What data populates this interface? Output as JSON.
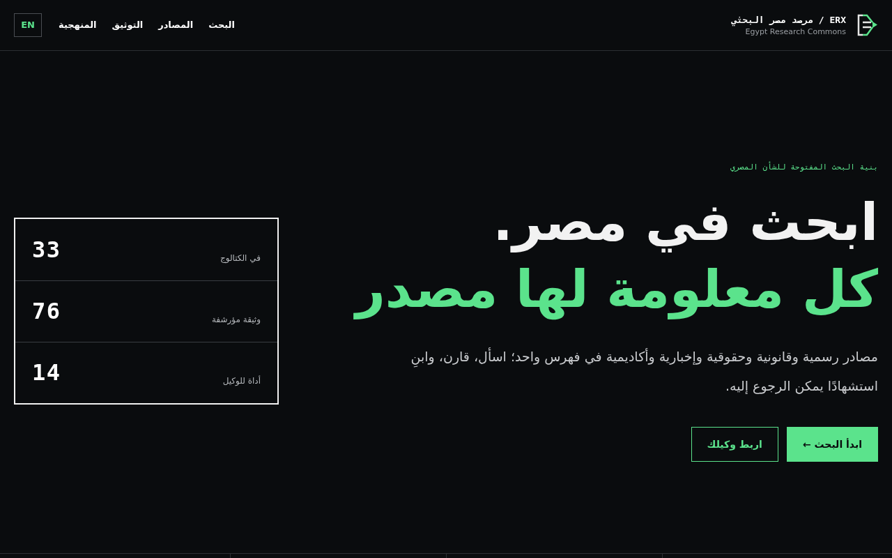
{
  "header": {
    "logo": {
      "title": "ERX / مرصد مصر البحثي",
      "subtitle": "Egypt Research Commons"
    },
    "nav": [
      {
        "label": "البحث"
      },
      {
        "label": "المصادر"
      },
      {
        "label": "التوثيق"
      },
      {
        "label": "المنهجية"
      }
    ],
    "language_button": "EN"
  },
  "hero": {
    "eyebrow": "بنية البحث المفتوحة للشأن المصري",
    "headline": {
      "line_1": "ابحث في مصر.",
      "line_2": "كل معلومة لها مصدر"
    },
    "description": "مصادر رسمية وقانونية وحقوقية وإخبارية وأكاديمية في فهرس واحد؛ اسأل، قارن، وابنِ استشهادًا يمكن الرجوع إليه.",
    "buttons": [
      {
        "label": "ابدأ البحث ←",
        "kind": "primary"
      },
      {
        "label": "اربط وكيلك",
        "kind": "outline"
      }
    ]
  },
  "stats": [
    {
      "value": "33",
      "label": "في الكتالوج"
    },
    {
      "value": "76",
      "label": "وثيقة مؤرشفة"
    },
    {
      "value": "14",
      "label": "أداة للوكيل"
    }
  ]
}
